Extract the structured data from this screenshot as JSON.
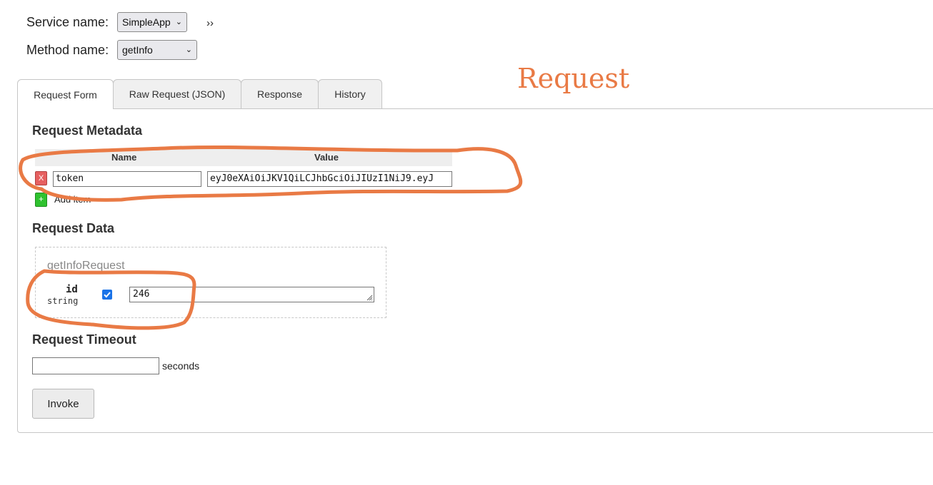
{
  "header": {
    "service_label": "Service name:",
    "service_value": "SimpleApp",
    "method_label": "Method name:",
    "method_value": "getInfo",
    "expand_glyph": "››",
    "dropdown_icon": "chevron-down-icon"
  },
  "annotation": {
    "title": "Request",
    "color": "#e97a45"
  },
  "tabs": [
    {
      "label": "Request Form",
      "active": true
    },
    {
      "label": "Raw Request (JSON)",
      "active": false
    },
    {
      "label": "Response",
      "active": false
    },
    {
      "label": "History",
      "active": false
    }
  ],
  "metadata": {
    "heading": "Request Metadata",
    "col_name": "Name",
    "col_value": "Value",
    "rows": [
      {
        "name": "token",
        "value": "eyJ0eXAiOiJKV1QiLCJhbGciOiJIUzI1NiJ9.eyJ"
      }
    ],
    "remove_glyph": "X",
    "add_glyph": "+",
    "add_label": "Add item"
  },
  "request_data": {
    "heading": "Request Data",
    "message_name": "getInfoRequest",
    "fields": [
      {
        "name": "id",
        "type": "string",
        "enabled": true,
        "value": "246"
      }
    ]
  },
  "timeout": {
    "heading": "Request Timeout",
    "value": "",
    "unit": "seconds"
  },
  "invoke_label": "Invoke"
}
